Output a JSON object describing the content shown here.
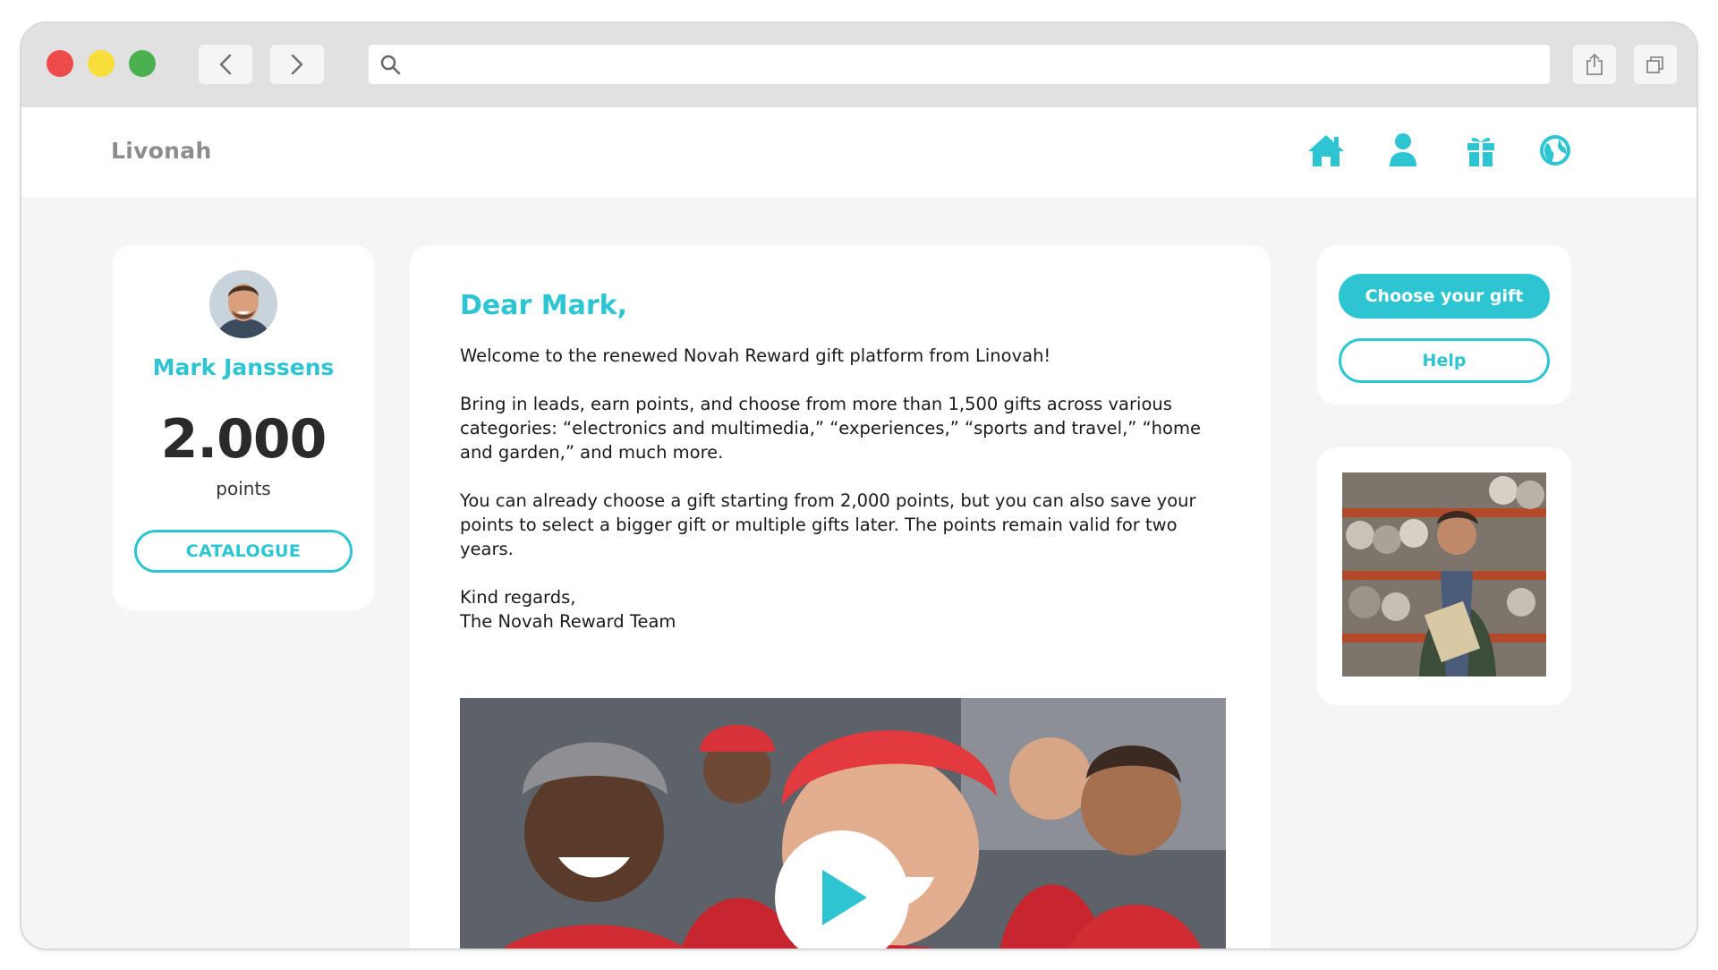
{
  "browser": {
    "url": ""
  },
  "site": {
    "logo": "Livonah",
    "nav_icons": [
      "home-icon",
      "user-icon",
      "gift-icon",
      "globe-icon"
    ]
  },
  "profile": {
    "name": "Mark Janssens",
    "points_value": "2.000",
    "points_label": "points",
    "catalogue_label": "CATALOGUE"
  },
  "message": {
    "greeting": "Dear Mark,",
    "paragraphs": [
      "Welcome to the renewed Novah Reward gift platform from Linovah!",
      "Bring in leads, earn points, and choose from more than 1,500 gifts across various categories: “electronics and multimedia,” “experiences,” “sports and travel,” “home and garden,” and much more.",
      "You can already choose a gift starting from 2,000 points, but you can also save your points to select a bigger gift or multiple gifts later. The points remain valid for two years."
    ],
    "closing": "Kind regards,",
    "signature": "The Novah Reward Team"
  },
  "actions": {
    "choose_label": "Choose your gift",
    "help_label": "Help"
  },
  "colors": {
    "accent": "#2ec5d3",
    "background": "#f4f6f5"
  }
}
